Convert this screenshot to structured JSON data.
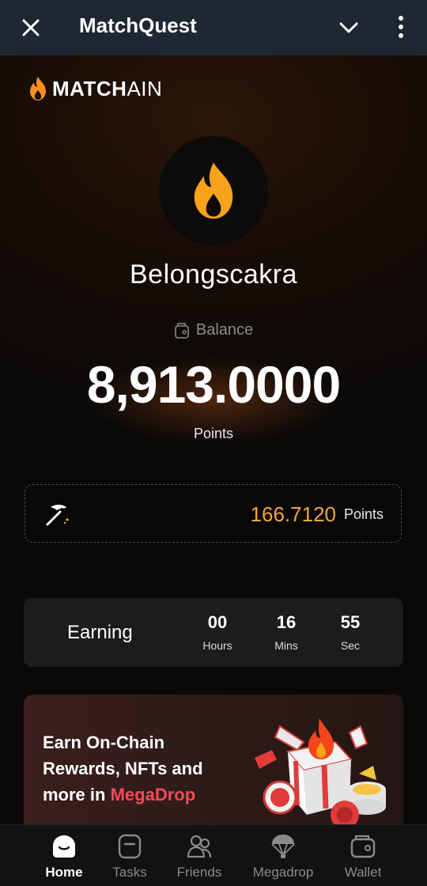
{
  "topbar": {
    "title": "MatchQuest",
    "close_icon": "close-icon",
    "dropdown_icon": "chevron-down-icon",
    "more_icon": "more-vertical-icon"
  },
  "brand": {
    "part1": "MATCH",
    "part2": "AIN",
    "logo_icon": "flame-icon"
  },
  "profile": {
    "username": "Belongscakra",
    "avatar_icon": "flame-icon"
  },
  "balance": {
    "label": "Balance",
    "value": "8,913.0000",
    "unit": "Points",
    "icon": "wallet-icon"
  },
  "mining": {
    "value": "166.7120",
    "unit": "Points",
    "icon": "pickaxe-icon"
  },
  "earning": {
    "label": "Earning",
    "hours": "00",
    "hours_label": "Hours",
    "mins": "16",
    "mins_label": "Mins",
    "secs": "55",
    "secs_label": "Sec"
  },
  "promo": {
    "line1": "Earn On-Chain",
    "line2": "Rewards, NFTs and",
    "line3_prefix": "more in ",
    "line3_highlight": "MegaDrop"
  },
  "nav": [
    {
      "label": "Home",
      "icon": "home-icon"
    },
    {
      "label": "Tasks",
      "icon": "tasks-icon"
    },
    {
      "label": "Friends",
      "icon": "friends-icon"
    },
    {
      "label": "Megadrop",
      "icon": "parachute-icon"
    },
    {
      "label": "Wallet",
      "icon": "wallet-icon"
    }
  ],
  "colors": {
    "accent": "#f0a63a",
    "megadrop": "#f24b5a",
    "topbar": "#1f2733",
    "background": "#0b0908"
  }
}
